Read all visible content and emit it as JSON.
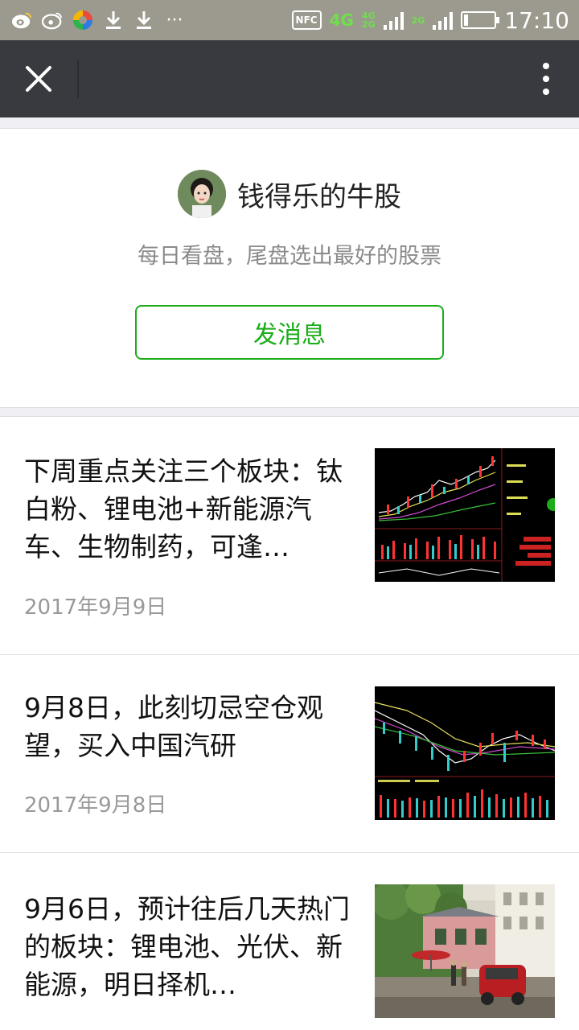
{
  "status_bar": {
    "left_icons": [
      "weibo-icon",
      "weibo-alt-icon",
      "app-icon",
      "download-icon",
      "download-icon",
      "more-notifications-icon"
    ],
    "more_text": "···",
    "nfc": "NFC",
    "network_primary": "4G",
    "network_stack_top": "4G",
    "network_stack_bottom": "2G",
    "network_secondary": "2G",
    "time": "17:10"
  },
  "titlebar": {
    "close_icon": "close-icon",
    "more_icon": "more-vertical-icon"
  },
  "profile": {
    "name": "钱得乐的牛股",
    "description": "每日看盘，尾盘选出最好的股票",
    "send_message_label": "发消息"
  },
  "articles": [
    {
      "title": "下周重点关注三个板块：钛白粉、锂电池+新能源汽车、生物制药，可逢…",
      "date": "2017年9月9日",
      "thumb": "stock-chart-thumbnail"
    },
    {
      "title": "9月8日，此刻切忌空仓观望，买入中国汽研",
      "date": "2017年9月8日",
      "thumb": "stock-chart-thumbnail"
    },
    {
      "title": "9月6日，预计往后几天热门的板块：锂电池、光伏、新能源，明日择机…",
      "date": "",
      "thumb": "street-photo-thumbnail"
    }
  ],
  "colors": {
    "status_bar": "#9c9a8e",
    "title_bar": "#393a3f",
    "accent_green": "#1aad19",
    "date_gray": "#999999"
  }
}
